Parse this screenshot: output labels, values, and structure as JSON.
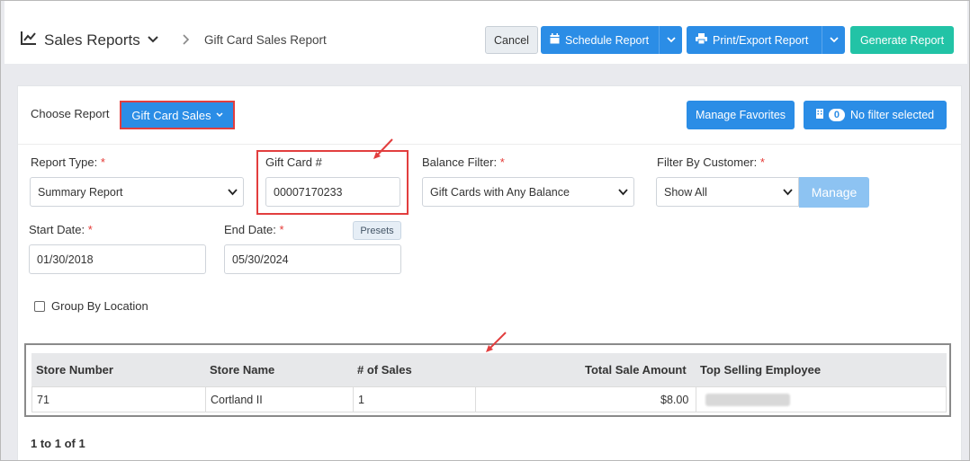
{
  "header": {
    "app_icon": "chart-line-icon",
    "title": "Sales Reports",
    "breadcrumb": "Gift Card Sales Report",
    "cancel_label": "Cancel",
    "schedule_label": "Schedule Report",
    "print_label": "Print/Export Report",
    "generate_label": "Generate Report"
  },
  "filters": {
    "choose_report_label": "Choose Report",
    "report_button_label": "Gift Card Sales",
    "manage_favorites_label": "Manage Favorites",
    "filter_count": "0",
    "no_filter_label": "No filter selected",
    "report_type_label": "Report Type:",
    "report_type_value": "Summary Report",
    "gift_card_label": "Gift Card #",
    "gift_card_value": "00007170233",
    "balance_filter_label": "Balance Filter:",
    "balance_filter_value": "Gift Cards with Any Balance",
    "customer_filter_label": "Filter By Customer:",
    "customer_filter_value": "Show All",
    "manage_label": "Manage",
    "start_date_label": "Start Date:",
    "start_date_value": "01/30/2018",
    "end_date_label": "End Date:",
    "end_date_value": "05/30/2024",
    "presets_label": "Presets",
    "group_by_location_label": "Group By Location",
    "required_mark": "*"
  },
  "table": {
    "columns": [
      "Store Number",
      "Store Name",
      "# of Sales",
      "Total Sale Amount",
      "Top Selling Employee"
    ],
    "rows": [
      {
        "store_number": "71",
        "store_name": "Cortland II",
        "sales": "1",
        "total": "$8.00"
      }
    ],
    "pager": "1 to 1 of 1"
  },
  "colors": {
    "primary": "#2b8de6",
    "teal": "#22c3a6",
    "highlight": "#e23e3e"
  }
}
